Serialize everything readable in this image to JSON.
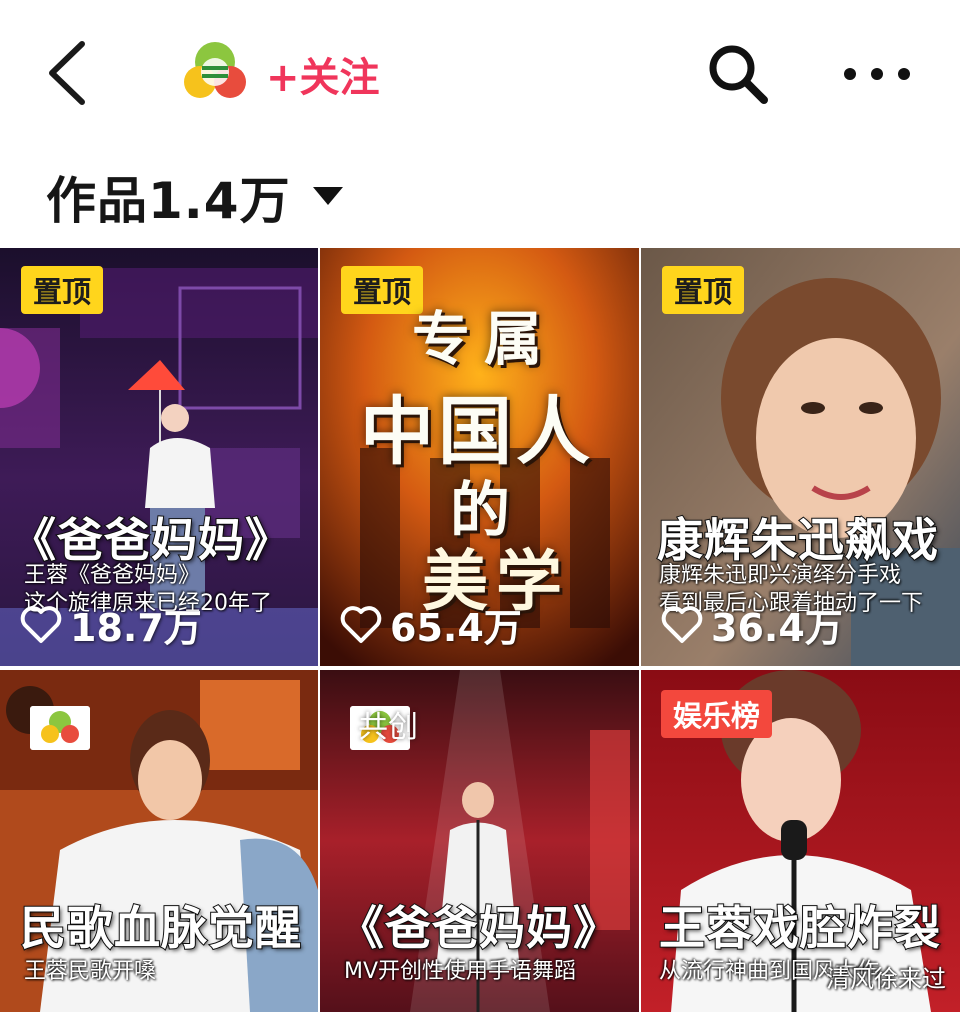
{
  "header": {
    "follow_label": "+关注",
    "works_label": "作品1.4万"
  },
  "videos": [
    {
      "badge": "置顶",
      "title": "《爸爸妈妈》",
      "sub1": "王蓉《爸爸妈妈》",
      "sub2": "这个旋律原来已经20年了",
      "likes": "18.7万"
    },
    {
      "badge": "置顶",
      "line1": "专属",
      "line2": "中国人",
      "line3": "的",
      "line4": "美学",
      "likes": "65.4万"
    },
    {
      "badge": "置顶",
      "title": "康辉朱迅飙戏",
      "sub1": "康辉朱迅即兴演绎分手戏",
      "sub2": "看到最后心跟着抽动了一下",
      "likes": "36.4万"
    },
    {
      "title": "民歌血脉觉醒",
      "sub1": "王蓉民歌开嗓"
    },
    {
      "co_label": "共创",
      "title": "《爸爸妈妈》",
      "sub1": "MV开创性使用手语舞蹈"
    },
    {
      "badge": "娱乐榜",
      "title": "王蓉戏腔炸裂",
      "sub1": "从流行神曲到国风大作"
    }
  ],
  "watermark": "清风徐来过",
  "colors": {
    "follow": "#f0355b",
    "pin_badge": "#ffd51c",
    "rank_badge": "#f3483d"
  }
}
